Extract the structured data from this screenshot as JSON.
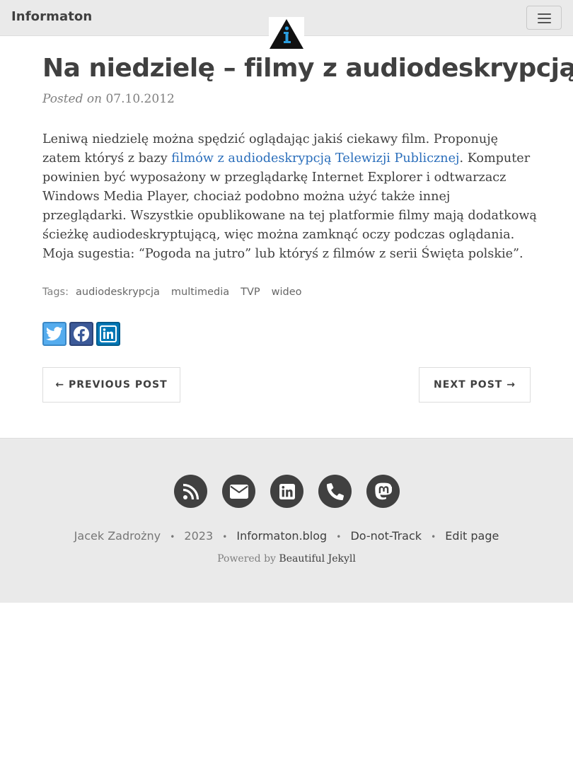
{
  "navbar": {
    "brand": "Informaton",
    "menu_icon": "hamburger-menu-icon",
    "logo_icon": "info-triangle-logo-icon"
  },
  "post": {
    "title": "Na niedzielę – filmy z audiodeskrypcją",
    "posted_on_label": "Posted on",
    "date": "07.10.2012",
    "body_part1": "Leniwą niedzielę można spędzić oglądając jakiś ciekawy film. Proponuję zatem któryś z bazy ",
    "body_link": "filmów z audiodeskrypcją Telewizji Publicznej",
    "body_part2": ". Komputer powinien być wyposażony w przeglądarkę Internet Explorer i odtwarzacz Windows Media Player, chociaż podobno można użyć także innej przeglądarki. Wszystkie opublikowane na tej platformie filmy mają dodatkową ścieżkę audiodeskryptującą, więc można zamknąć oczy podczas oglądania. Moja sugestia: “Pogoda na jutro” lub któryś z filmów z serii Święta polskie”."
  },
  "tags": {
    "label": "Tags:",
    "items": [
      "audiodeskrypcja",
      "multimedia",
      "TVP",
      "wideo"
    ]
  },
  "share": {
    "icons": [
      "twitter-icon",
      "facebook-icon",
      "linkedin-icon"
    ],
    "colors": {
      "twitter": "#55acee",
      "facebook": "#3b5998",
      "linkedin": "#0077b5"
    }
  },
  "pager": {
    "previous": "← PREVIOUS POST",
    "next": "NEXT POST →"
  },
  "footer": {
    "social_icons": [
      "rss-icon",
      "envelope-icon",
      "linkedin-icon",
      "phone-icon",
      "mastodon-icon"
    ],
    "author": "Jacek Zadrożny",
    "sep": "•",
    "year": "2023",
    "site": "Informaton.blog",
    "dnt": "Do-not-Track",
    "edit": "Edit page",
    "powered_by": "Powered by",
    "theme": "Beautiful Jekyll"
  },
  "colors": {
    "navbar_bg": "#eaeaea",
    "footer_bg": "#eaeaea",
    "text": "#404040",
    "link": "#2a6ebb"
  }
}
